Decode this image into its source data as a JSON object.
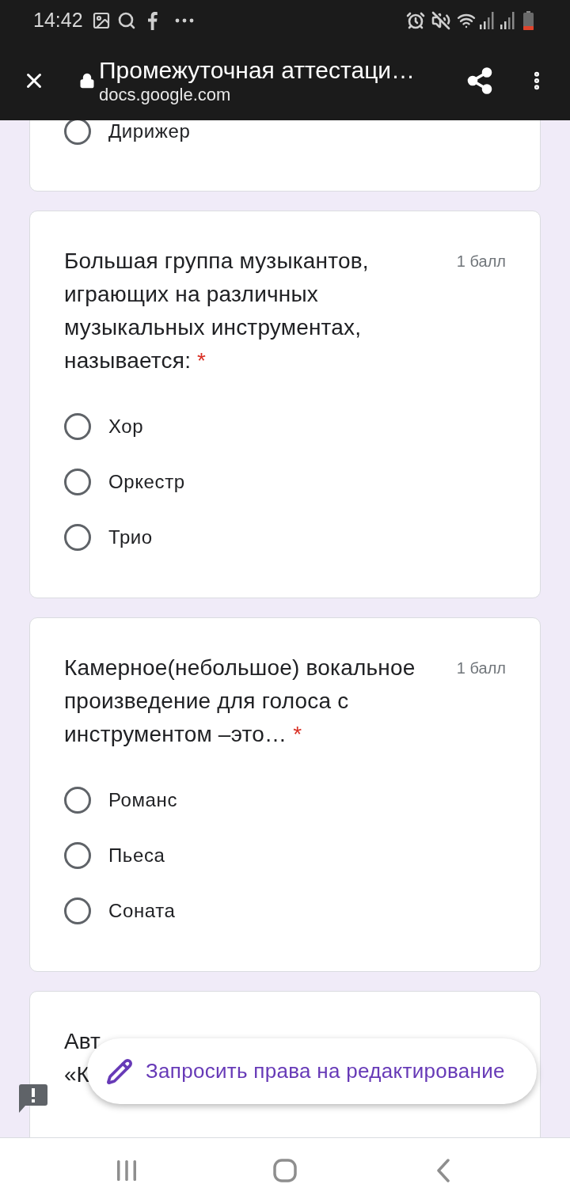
{
  "status_bar": {
    "time": "14:42"
  },
  "toolbar": {
    "title": "Промежуточная аттестаци…",
    "url": "docs.google.com"
  },
  "cards": [
    {
      "kind": "cut_top",
      "options": [
        {
          "label": "Дирижер",
          "selected": false
        }
      ]
    },
    {
      "kind": "full",
      "title": "Большая группа музыкантов, играющих на различных музыкальных инструментах, называется:",
      "required_mark": "*",
      "points": "1 балл",
      "options": [
        {
          "label": "Хор",
          "selected": false
        },
        {
          "label": "Оркестр",
          "selected": false
        },
        {
          "label": "Трио",
          "selected": false
        }
      ]
    },
    {
      "kind": "full",
      "title": "Камерное(небольшое) вокальное произведение для голоса с инструментом –это…",
      "required_mark": "*",
      "points": "1 балл",
      "options": [
        {
          "label": "Романс",
          "selected": false
        },
        {
          "label": "Пьеса",
          "selected": false
        },
        {
          "label": "Соната",
          "selected": false
        }
      ]
    },
    {
      "kind": "cut_bottom",
      "title_lines": [
        "Авт",
        "«К"
      ]
    }
  ],
  "edit_request_button": {
    "label": "Запросить права на редактирование"
  }
}
